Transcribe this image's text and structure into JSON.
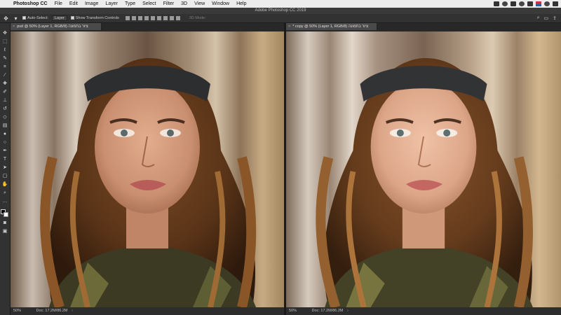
{
  "menubar": {
    "app_name": "Photoshop CC",
    "items": [
      "File",
      "Edit",
      "Image",
      "Layer",
      "Type",
      "Select",
      "Filter",
      "3D",
      "View",
      "Window",
      "Help"
    ]
  },
  "titlebar": {
    "title": "Adobe Photoshop CC 2019"
  },
  "options": {
    "auto_select_label": "Auto-Select:",
    "layer_select_value": "Layer",
    "transform_label": "Show Transform Controls",
    "mode_3d_label": "3D Mode:"
  },
  "documents": [
    {
      "tab_label": "psd @ 50% (Layer 1, RGB/8) ציור בתמונה",
      "zoom": "50%",
      "doc_size": "Doc: 17.2M/86.2M",
      "tone": "original"
    },
    {
      "tab_label": "* copy @ 50% (Layer 1, RGB/8) ציור בתמונה",
      "zoom": "50%",
      "doc_size": "Doc: 17.2M/86.2M",
      "tone": "retouched"
    }
  ],
  "tools": [
    "move-icon",
    "marquee-icon",
    "lasso-icon",
    "quick-select-icon",
    "crop-icon",
    "eyedropper-icon",
    "healing-icon",
    "brush-icon",
    "stamp-icon",
    "history-brush-icon",
    "eraser-icon",
    "gradient-icon",
    "blur-icon",
    "dodge-icon",
    "pen-icon",
    "type-icon",
    "path-select-icon",
    "shape-icon",
    "hand-icon",
    "zoom-icon"
  ],
  "colors": {
    "accent": "#323232",
    "canvas_bg": "#282828"
  }
}
